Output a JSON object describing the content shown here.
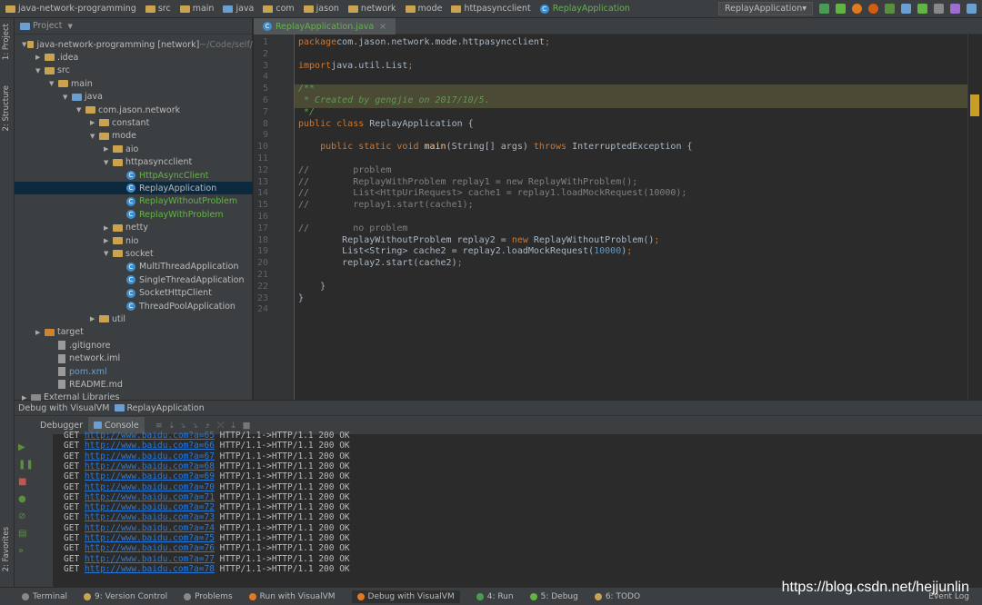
{
  "breadcrumbs": [
    "java-network-programming",
    "src",
    "main",
    "java",
    "com",
    "jason",
    "network",
    "mode",
    "httpasyncclient",
    "ReplayApplication"
  ],
  "run_config": "ReplayApplication",
  "left_tabs": [
    "1: Project",
    "2: Structure",
    "2: Favorites"
  ],
  "project": {
    "title": "Project",
    "tree": [
      {
        "label": "java-network-programming [network]",
        "suffix": " ~/Code/self/",
        "lvl": 0,
        "type": "module",
        "open": true
      },
      {
        "label": ".idea",
        "lvl": 1,
        "type": "folder",
        "open": false
      },
      {
        "label": "src",
        "lvl": 1,
        "type": "folder",
        "open": true
      },
      {
        "label": "main",
        "lvl": 2,
        "type": "folder",
        "open": true
      },
      {
        "label": "java",
        "lvl": 3,
        "type": "src",
        "open": true
      },
      {
        "label": "com.jason.network",
        "lvl": 4,
        "type": "pkg",
        "open": true
      },
      {
        "label": "constant",
        "lvl": 5,
        "type": "pkg",
        "open": false
      },
      {
        "label": "mode",
        "lvl": 5,
        "type": "pkg",
        "open": true
      },
      {
        "label": "aio",
        "lvl": 6,
        "type": "pkg",
        "open": false
      },
      {
        "label": "httpasyncclient",
        "lvl": 6,
        "type": "pkg",
        "open": true
      },
      {
        "label": "HttpAsyncClient",
        "lvl": 7,
        "type": "class",
        "color": "#62b543"
      },
      {
        "label": "ReplayApplication",
        "lvl": 7,
        "type": "class",
        "selected": true
      },
      {
        "label": "ReplayWithoutProblem",
        "lvl": 7,
        "type": "class",
        "color": "#62b543"
      },
      {
        "label": "ReplayWithProblem",
        "lvl": 7,
        "type": "class",
        "color": "#62b543"
      },
      {
        "label": "netty",
        "lvl": 6,
        "type": "pkg",
        "open": false
      },
      {
        "label": "nio",
        "lvl": 6,
        "type": "pkg",
        "open": false
      },
      {
        "label": "socket",
        "lvl": 6,
        "type": "pkg",
        "open": true
      },
      {
        "label": "MultiThreadApplication",
        "lvl": 7,
        "type": "class"
      },
      {
        "label": "SingleThreadApplication",
        "lvl": 7,
        "type": "class"
      },
      {
        "label": "SocketHttpClient",
        "lvl": 7,
        "type": "class"
      },
      {
        "label": "ThreadPoolApplication",
        "lvl": 7,
        "type": "class"
      },
      {
        "label": "util",
        "lvl": 5,
        "type": "pkg",
        "open": false
      },
      {
        "label": "target",
        "lvl": 1,
        "type": "target",
        "open": false
      },
      {
        "label": ".gitignore",
        "lvl": 2,
        "type": "file"
      },
      {
        "label": "network.iml",
        "lvl": 2,
        "type": "file"
      },
      {
        "label": "pom.xml",
        "lvl": 2,
        "type": "maven",
        "color": "#6a9fd3"
      },
      {
        "label": "README.md",
        "lvl": 2,
        "type": "file"
      },
      {
        "label": "External Libraries",
        "lvl": 0,
        "type": "lib",
        "open": false
      }
    ]
  },
  "editor": {
    "tab": "ReplayApplication.java",
    "lines": [
      [
        [
          "kw",
          "package"
        ],
        [
          "",
          "com.jason.network.mode.httpasyncclient"
        ],
        [
          "kw",
          ";"
        ]
      ],
      [],
      [
        [
          "kw",
          "import"
        ],
        [
          "",
          "java.util.List"
        ],
        [
          "kw",
          ";"
        ]
      ],
      [],
      [
        [
          "dc",
          "/**"
        ]
      ],
      [
        [
          "dc",
          " * Created by gengjie on 2017/10/5."
        ]
      ],
      [
        [
          "dc",
          " */"
        ]
      ],
      [
        [
          "kw",
          "public class "
        ],
        [
          "",
          "ReplayApplication {"
        ]
      ],
      [],
      [
        [
          "",
          "    "
        ],
        [
          "kw",
          "public static void "
        ],
        [
          "fn",
          "main"
        ],
        [
          "",
          "(String[] args) "
        ],
        [
          "kw",
          "throws "
        ],
        [
          "",
          "InterruptedException {"
        ]
      ],
      [],
      [
        [
          "cm",
          "//        problem"
        ]
      ],
      [
        [
          "cm",
          "//        ReplayWithProblem replay1 = new ReplayWithProblem();"
        ]
      ],
      [
        [
          "cm",
          "//        List<HttpUriRequest> cache1 = replay1.loadMockRequest(10000);"
        ]
      ],
      [
        [
          "cm",
          "//        replay1.start(cache1);"
        ]
      ],
      [],
      [
        [
          "cm",
          "//        no problem"
        ]
      ],
      [
        [
          "",
          "        ReplayWithoutProblem replay2 = "
        ],
        [
          "kw",
          "new "
        ],
        [
          "",
          "ReplayWithoutProblem()"
        ],
        [
          "kw",
          ";"
        ]
      ],
      [
        [
          "",
          "        List<String> cache2 = replay2.loadMockRequest("
        ],
        [
          "num",
          "10000"
        ],
        [
          "",
          ")"
        ],
        [
          "kw",
          ";"
        ]
      ],
      [
        [
          "",
          "        replay2.start(cache2)"
        ],
        [
          "kw",
          ";"
        ]
      ],
      [],
      [
        [
          "",
          "    }"
        ]
      ],
      [
        [
          "",
          "}"
        ]
      ],
      []
    ]
  },
  "debug": {
    "title": "Debug with VisualVM",
    "config": "ReplayApplication",
    "tabs": [
      "Debugger",
      "Console"
    ],
    "console": {
      "method": "GET",
      "url_prefix": "http://www.baidu.com?a=",
      "ids": [
        65,
        66,
        67,
        68,
        69,
        70,
        71,
        72,
        73,
        74,
        75,
        76,
        77,
        78
      ],
      "result": "HTTP/1.1->HTTP/1.1 200 OK"
    }
  },
  "statusbar": [
    "Terminal",
    "9: Version Control",
    "Problems",
    "Run with VisualVM",
    "Debug with VisualVM",
    "4: Run",
    "5: Debug",
    "6: TODO"
  ],
  "event_log": "Event Log",
  "watermark": "https://blog.csdn.net/hejjunlin"
}
